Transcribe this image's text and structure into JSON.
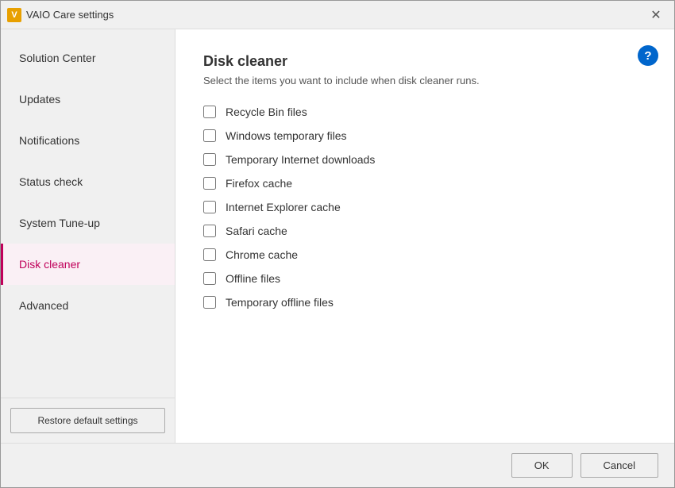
{
  "window": {
    "title": "VAIO Care settings",
    "icon_label": "V"
  },
  "sidebar": {
    "items": [
      {
        "id": "solution-center",
        "label": "Solution Center",
        "active": false
      },
      {
        "id": "updates",
        "label": "Updates",
        "active": false
      },
      {
        "id": "notifications",
        "label": "Notifications",
        "active": false
      },
      {
        "id": "status-check",
        "label": "Status check",
        "active": false
      },
      {
        "id": "system-tune-up",
        "label": "System Tune-up",
        "active": false
      },
      {
        "id": "disk-cleaner",
        "label": "Disk cleaner",
        "active": true
      },
      {
        "id": "advanced",
        "label": "Advanced",
        "active": false
      }
    ],
    "restore_btn_label": "Restore default settings"
  },
  "main": {
    "title": "Disk cleaner",
    "subtitle": "Select the items you want to include when disk cleaner runs.",
    "help_icon": "?",
    "checkboxes": [
      {
        "id": "recycle-bin",
        "label": "Recycle Bin files",
        "checked": false
      },
      {
        "id": "windows-temp",
        "label": "Windows temporary files",
        "checked": false
      },
      {
        "id": "temp-internet",
        "label": "Temporary Internet downloads",
        "checked": false
      },
      {
        "id": "firefox-cache",
        "label": "Firefox cache",
        "checked": false
      },
      {
        "id": "ie-cache",
        "label": "Internet Explorer cache",
        "checked": false
      },
      {
        "id": "safari-cache",
        "label": "Safari cache",
        "checked": false
      },
      {
        "id": "chrome-cache",
        "label": "Chrome cache",
        "checked": false
      },
      {
        "id": "offline-files",
        "label": "Offline files",
        "checked": false
      },
      {
        "id": "temp-offline",
        "label": "Temporary offline files",
        "checked": false
      }
    ]
  },
  "footer": {
    "ok_label": "OK",
    "cancel_label": "Cancel"
  }
}
